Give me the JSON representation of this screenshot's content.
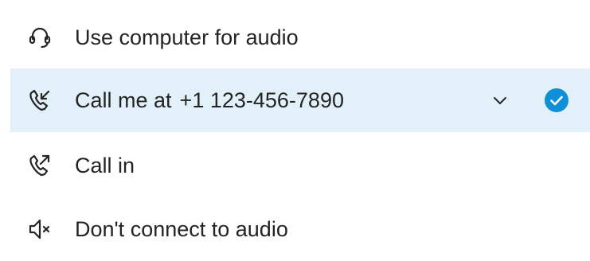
{
  "audio_options": [
    {
      "id": "computer",
      "label": "Use computer for audio",
      "icon": "headset-icon"
    },
    {
      "id": "call-me",
      "label": "Call me at",
      "phone": "+1 123-456-7890",
      "icon": "phone-incoming-icon",
      "selected": true
    },
    {
      "id": "call-in",
      "label": "Call in",
      "icon": "phone-outgoing-icon"
    },
    {
      "id": "no-audio",
      "label": "Don't connect to audio",
      "icon": "speaker-mute-icon"
    }
  ],
  "colors": {
    "selected_background": "#e2f1f9",
    "check_accent": "#0f8fd8",
    "text": "#242424"
  }
}
